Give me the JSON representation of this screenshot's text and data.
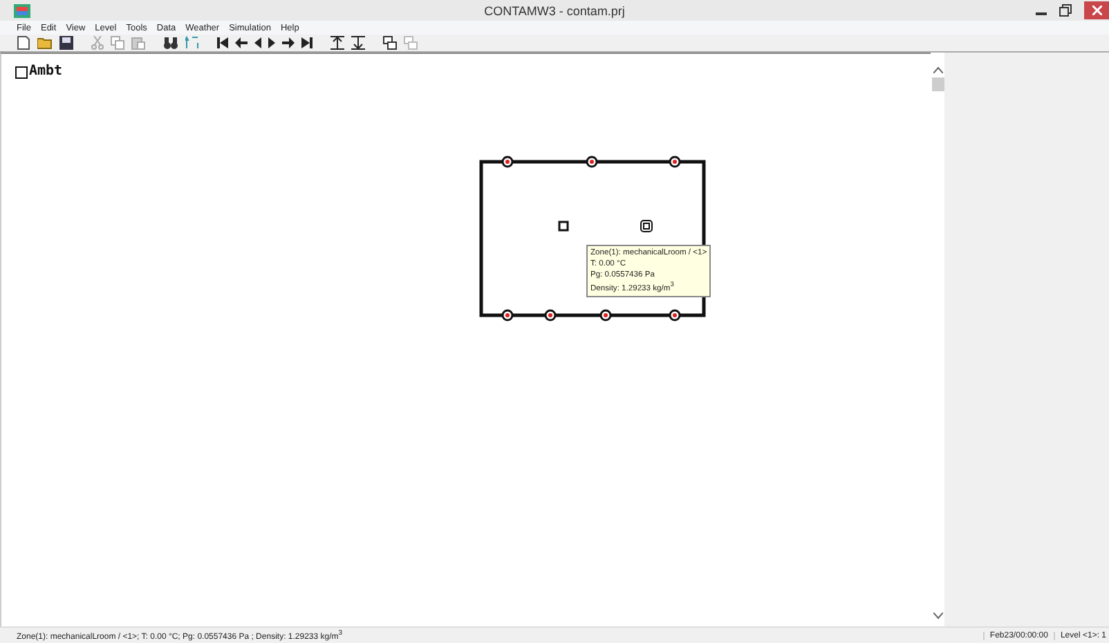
{
  "window": {
    "title": "CONTAMW3 - contam.prj"
  },
  "menu": [
    "File",
    "Edit",
    "View",
    "Level",
    "Tools",
    "Data",
    "Weather",
    "Simulation",
    "Help"
  ],
  "canvas": {
    "ambient_label": "Ambt",
    "tooltip": [
      "Zone(1): mechanicalLroom / <1>",
      "T: 0.00 °C",
      "Pg: 0.0557436 Pa",
      "Density: 1.29233 kg/m$^{3}$"
    ]
  },
  "status_bar": {
    "message": "Zone(1): mechanicalLroom / <1>; T: 0.00 °C; Pg: 0.0557436 Pa ; Density: 1.29233 kg/m$^{3}$",
    "time": "Feb23/00:00:00",
    "level": "Level <1>: 1"
  }
}
